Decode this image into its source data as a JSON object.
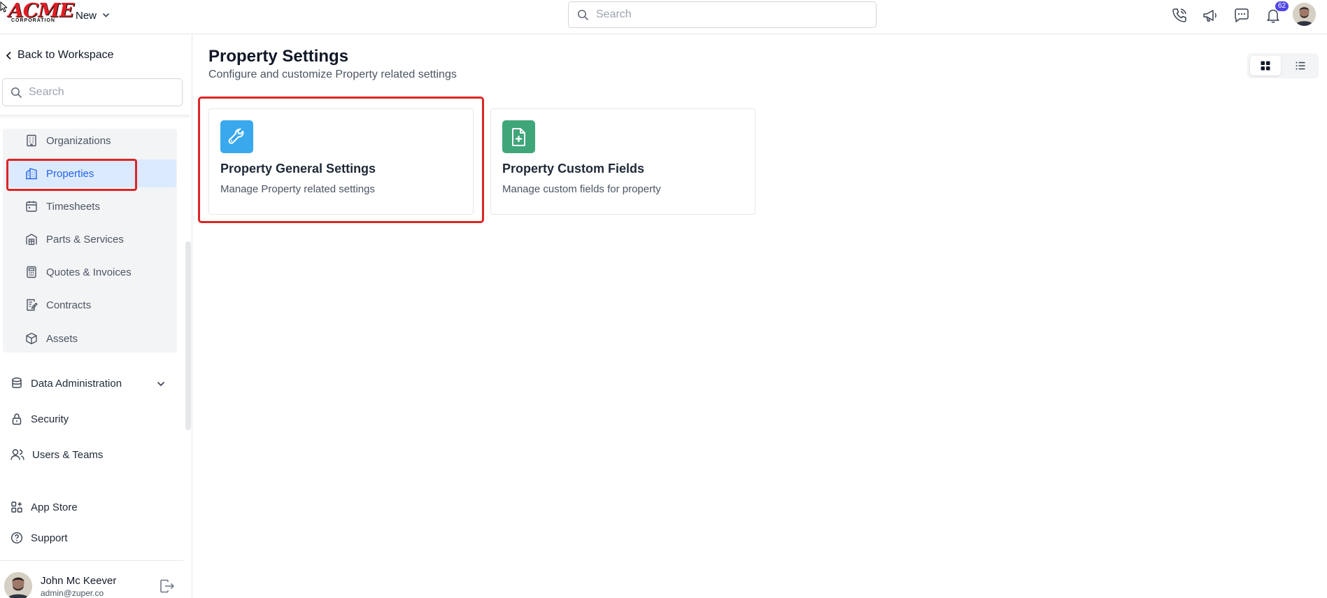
{
  "header": {
    "logo_text": "ACME",
    "logo_subtext": "CORPORATION",
    "new_label": "New",
    "search_placeholder": "Search",
    "notification_count": "62",
    "icons": [
      "phone-icon",
      "megaphone-icon",
      "chat-icon",
      "bell-icon"
    ]
  },
  "sidebar": {
    "back_label": "Back to Workspace",
    "search_placeholder": "Search",
    "sub_items": [
      {
        "label": "Organizations",
        "icon": "building-icon"
      },
      {
        "label": "Properties",
        "icon": "property-icon",
        "active": true
      },
      {
        "label": "Timesheets",
        "icon": "calendar-icon"
      },
      {
        "label": "Parts & Services",
        "icon": "warehouse-icon"
      },
      {
        "label": "Quotes & Invoices",
        "icon": "calculator-icon"
      },
      {
        "label": "Contracts",
        "icon": "contract-icon"
      },
      {
        "label": "Assets",
        "icon": "cube-icon"
      }
    ],
    "main_items": [
      {
        "label": "Data Administration",
        "icon": "database-icon"
      },
      {
        "label": "Security",
        "icon": "lock-icon"
      },
      {
        "label": "Users & Teams",
        "icon": "users-icon"
      },
      {
        "label": "App Store",
        "icon": "apps-icon"
      },
      {
        "label": "Support",
        "icon": "help-icon"
      }
    ],
    "user": {
      "name": "John Mc Keever",
      "email": "admin@zuper.co"
    }
  },
  "main": {
    "title": "Property Settings",
    "subtitle": "Configure and customize Property related settings",
    "cards": [
      {
        "title": "Property General Settings",
        "description": "Manage Property related settings",
        "icon": "wrench-icon",
        "color": "#3aa8ec"
      },
      {
        "title": "Property Custom Fields",
        "description": "Manage custom fields for property",
        "icon": "file-plus-icon",
        "color": "#3fa67a"
      }
    ]
  },
  "colors": {
    "accent": "#2563eb",
    "highlight": "#dc2626",
    "active_bg": "#dbeafe"
  }
}
